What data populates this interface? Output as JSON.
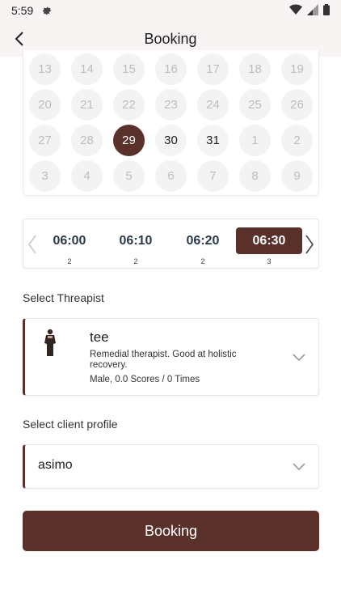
{
  "status_bar": {
    "time": "5:59"
  },
  "header": {
    "title": "Booking"
  },
  "calendar": {
    "selected_day": "29",
    "rows": [
      [
        {
          "d": "13",
          "s": "muted"
        },
        {
          "d": "14",
          "s": "muted"
        },
        {
          "d": "15",
          "s": "muted"
        },
        {
          "d": "16",
          "s": "muted"
        },
        {
          "d": "17",
          "s": "muted"
        },
        {
          "d": "18",
          "s": "muted"
        },
        {
          "d": "19",
          "s": "muted"
        }
      ],
      [
        {
          "d": "20",
          "s": "muted"
        },
        {
          "d": "21",
          "s": "muted"
        },
        {
          "d": "22",
          "s": "muted"
        },
        {
          "d": "23",
          "s": "muted"
        },
        {
          "d": "24",
          "s": "muted"
        },
        {
          "d": "25",
          "s": "muted"
        },
        {
          "d": "26",
          "s": "muted"
        }
      ],
      [
        {
          "d": "27",
          "s": "muted"
        },
        {
          "d": "28",
          "s": "muted"
        },
        {
          "d": "29",
          "s": "selected"
        },
        {
          "d": "30",
          "s": "active"
        },
        {
          "d": "31",
          "s": "active"
        },
        {
          "d": "1",
          "s": "muted"
        },
        {
          "d": "2",
          "s": "muted"
        }
      ],
      [
        {
          "d": "3",
          "s": "muted"
        },
        {
          "d": "4",
          "s": "muted"
        },
        {
          "d": "5",
          "s": "muted"
        },
        {
          "d": "6",
          "s": "muted"
        },
        {
          "d": "7",
          "s": "muted"
        },
        {
          "d": "8",
          "s": "muted"
        },
        {
          "d": "9",
          "s": "muted"
        }
      ]
    ]
  },
  "timeslots": {
    "slots": [
      {
        "time": "06:00",
        "count": "2",
        "selected": false
      },
      {
        "time": "06:10",
        "count": "2",
        "selected": false
      },
      {
        "time": "06:20",
        "count": "2",
        "selected": false
      },
      {
        "time": "06:30",
        "count": "3",
        "selected": true
      }
    ]
  },
  "therapist_section": {
    "label": "Select Threapist",
    "name": "tee",
    "description": "Remedial therapist. Good at holistic recovery.",
    "stats": "Male, 0.0 Scores / 0 Times"
  },
  "profile_section": {
    "label": "Select client profile",
    "value": "asimo"
  },
  "booking_button": {
    "label": "Booking"
  },
  "colors": {
    "accent": "#5a302b",
    "header_bg": "#f9f4f4"
  }
}
